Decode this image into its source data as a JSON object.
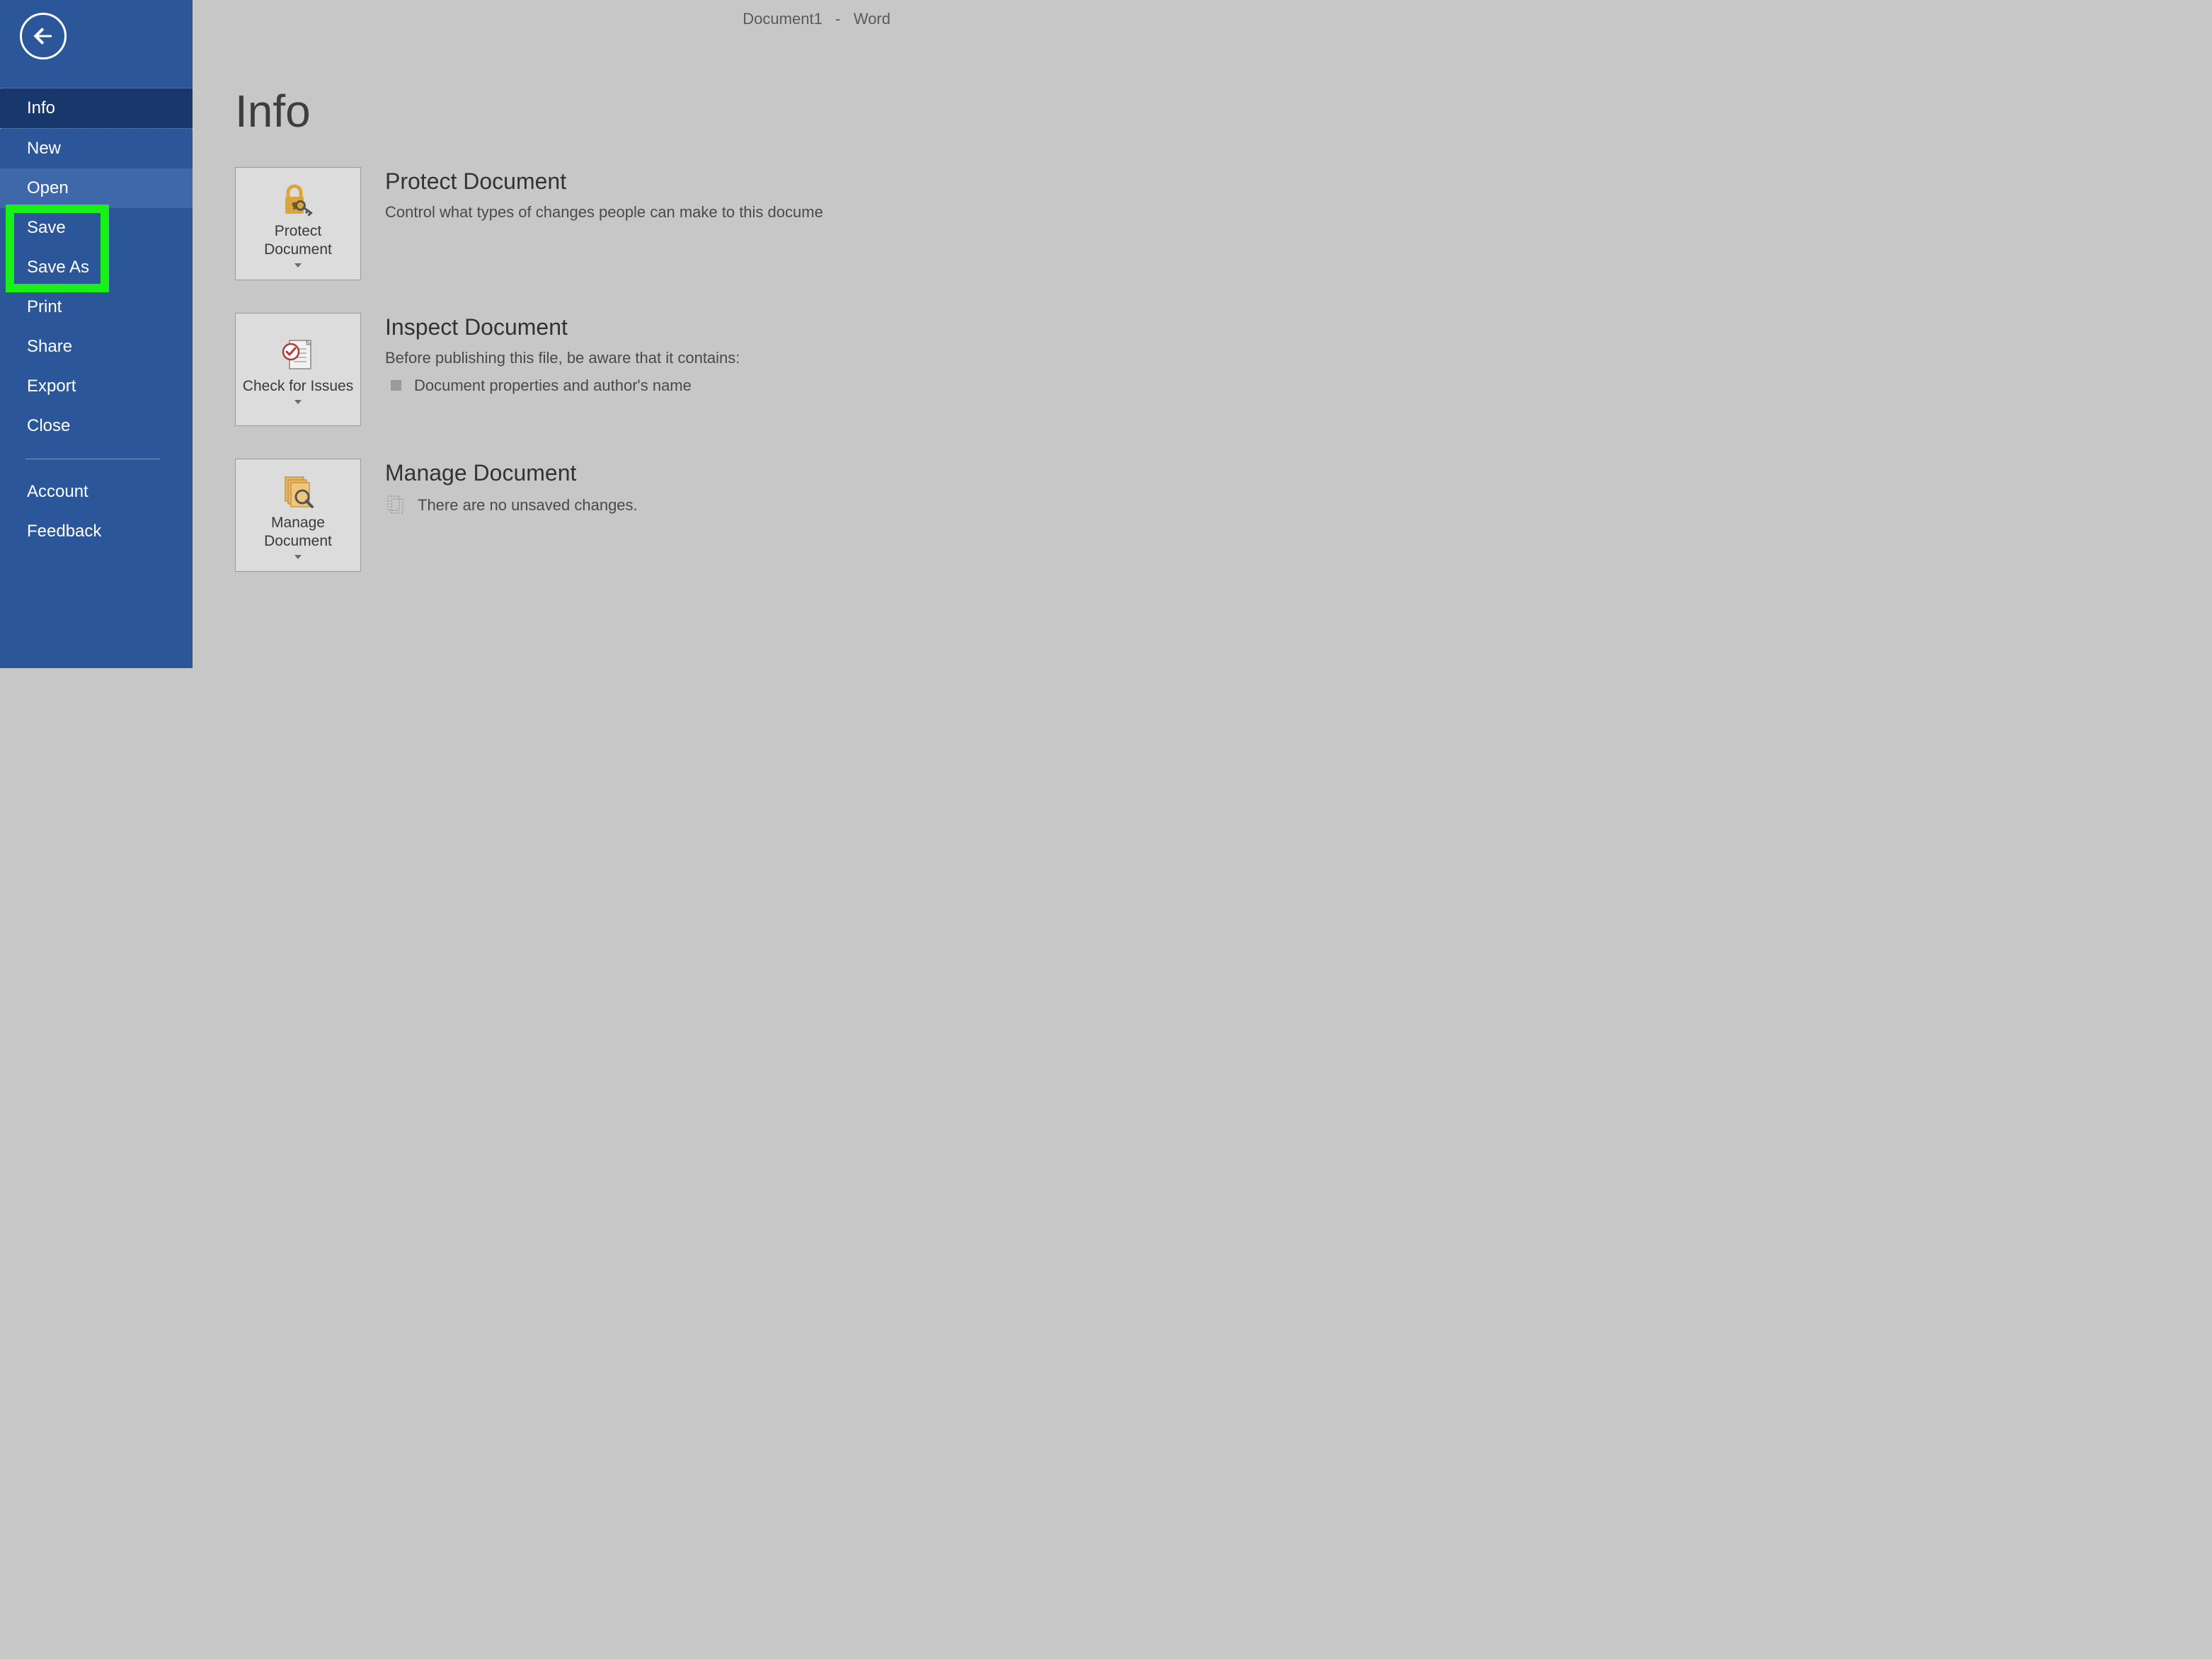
{
  "titlebar": {
    "doc_name": "Document1",
    "separator": "-",
    "app_name": "Word"
  },
  "sidebar": {
    "items": [
      {
        "label": "Info",
        "active": true
      },
      {
        "label": "New"
      },
      {
        "label": "Open",
        "hover": true
      },
      {
        "label": "Save"
      },
      {
        "label": "Save As"
      },
      {
        "label": "Print"
      },
      {
        "label": "Share"
      },
      {
        "label": "Export"
      },
      {
        "label": "Close"
      }
    ],
    "footer_items": [
      {
        "label": "Account"
      },
      {
        "label": "Feedback"
      }
    ]
  },
  "main": {
    "page_title": "Info",
    "sections": {
      "protect": {
        "tile_label": "Protect Document",
        "heading": "Protect Document",
        "desc": "Control what types of changes people can make to this docume"
      },
      "inspect": {
        "tile_label": "Check for Issues",
        "heading": "Inspect Document",
        "desc": "Before publishing this file, be aware that it contains:",
        "bullet": "Document properties and author's name"
      },
      "manage": {
        "tile_label": "Manage Document",
        "heading": "Manage Document",
        "desc": "There are no unsaved changes."
      }
    }
  }
}
